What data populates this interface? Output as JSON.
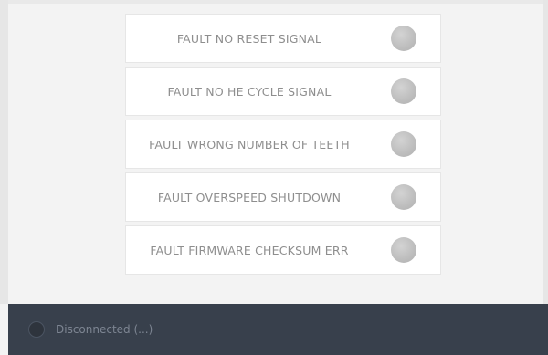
{
  "faults": [
    {
      "label": "FAULT NO RESET SIGNAL",
      "status_icon": "status-led-grey"
    },
    {
      "label": "FAULT NO HE CYCLE SIGNAL",
      "status_icon": "status-led-grey"
    },
    {
      "label": "FAULT WRONG NUMBER OF TEETH",
      "status_icon": "status-led-grey"
    },
    {
      "label": "FAULT OVERSPEED SHUTDOWN",
      "status_icon": "status-led-grey"
    },
    {
      "label": "FAULT FIRMWARE CHECKSUM ERR",
      "status_icon": "status-led-grey"
    }
  ],
  "status_bar": {
    "text": "Disconnected (...)",
    "icon": "connection-status-icon"
  },
  "colors": {
    "status_bar_background": "#38404c",
    "led_inactive": "#bdbdbd",
    "label_text": "#8e8e8e"
  }
}
